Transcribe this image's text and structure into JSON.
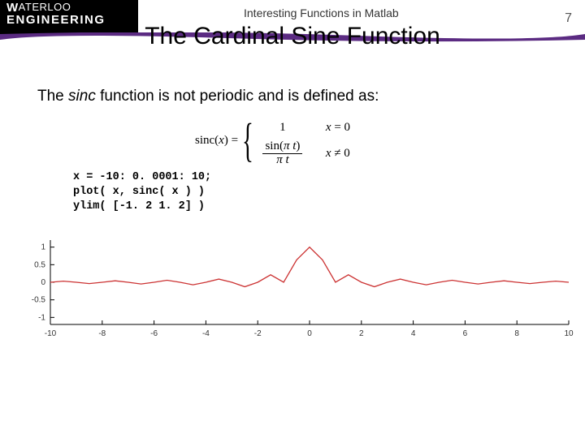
{
  "header": {
    "logo_line1_rest": "ATERLOO",
    "logo_line2": "ENGINEERING",
    "subtitle": "Interesting Functions in Matlab",
    "page_number": "7"
  },
  "slide": {
    "title": "The Cardinal Sine Function",
    "body_prefix": "The ",
    "body_fn": "sinc",
    "body_suffix": " function is not periodic and is defined as:"
  },
  "equation": {
    "lhs": "sinc(x) =",
    "case1_val": "1",
    "case1_cond": "x = 0",
    "case2_num": "sin(π t)",
    "case2_den": "π t",
    "case2_cond": "x ≠ 0"
  },
  "code": {
    "line1": "x = -10: 0. 0001: 10;",
    "line2": "plot( x, sinc( x ) )",
    "line3": "ylim( [-1. 2 1. 2] )"
  },
  "chart_data": {
    "type": "line",
    "title": "",
    "xlabel": "",
    "ylabel": "",
    "xlim": [
      -10,
      10
    ],
    "ylim": [
      -1.2,
      1.2
    ],
    "x_ticks": [
      -10,
      -8,
      -6,
      -4,
      -2,
      0,
      2,
      4,
      6,
      8,
      10
    ],
    "y_ticks": [
      -1,
      -0.5,
      0,
      0.5,
      1
    ],
    "y_tick_labels": [
      "-1",
      "-0.5",
      "0",
      "0.5",
      "1"
    ],
    "series": [
      {
        "name": "sinc(x)",
        "color": "#cc3333",
        "x": [
          -10,
          -9.5,
          -9,
          -8.5,
          -8,
          -7.5,
          -7,
          -6.5,
          -6,
          -5.5,
          -5,
          -4.5,
          -4,
          -3.5,
          -3,
          -2.5,
          -2,
          -1.5,
          -1,
          -0.5,
          0,
          0.5,
          1,
          1.5,
          2,
          2.5,
          3,
          3.5,
          4,
          4.5,
          5,
          5.5,
          6,
          6.5,
          7,
          7.5,
          8,
          8.5,
          9,
          9.5,
          10
        ],
        "y": [
          0,
          0.033,
          0,
          -0.037,
          0,
          0.042,
          0,
          -0.049,
          0,
          0.058,
          0,
          -0.071,
          0,
          0.091,
          0,
          -0.127,
          0,
          0.212,
          0,
          0.637,
          1,
          0.637,
          0,
          0.212,
          0,
          -0.127,
          0,
          0.091,
          0,
          -0.071,
          0,
          0.058,
          0,
          -0.049,
          0,
          0.042,
          0,
          -0.037,
          0,
          0.033,
          0
        ]
      }
    ]
  }
}
